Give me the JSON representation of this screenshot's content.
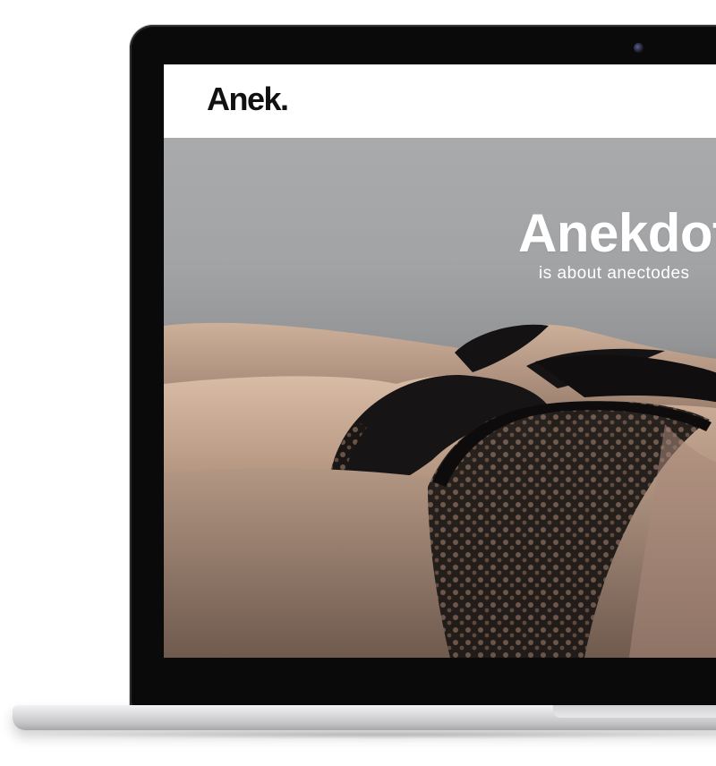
{
  "site": {
    "logo_text": "Anek."
  },
  "hero": {
    "title": "Anekdot",
    "subtitle": "is about anectodes"
  },
  "colors": {
    "background": "#ffffff",
    "bezel": "#0a0a0b",
    "hero_text": "#ffffff",
    "logo_text": "#111111"
  },
  "icons": {
    "camera": "webcam-icon"
  }
}
